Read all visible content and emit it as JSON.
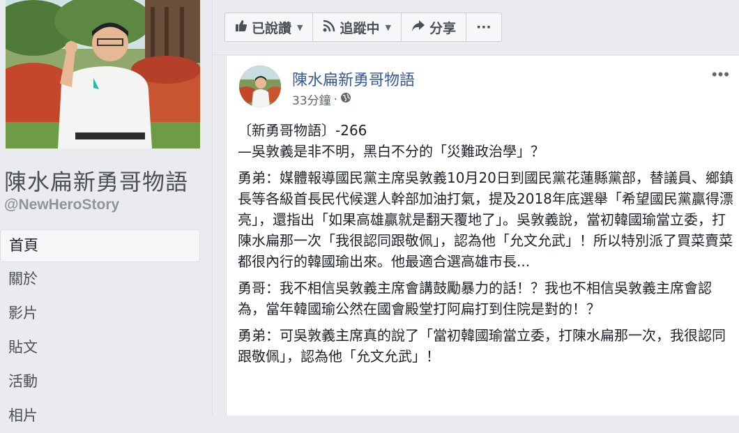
{
  "page": {
    "name": "陳水扁新勇哥物語",
    "handle": "@NewHeroStory"
  },
  "nav": [
    {
      "label": "首頁"
    },
    {
      "label": "關於"
    },
    {
      "label": "影片"
    },
    {
      "label": "貼文"
    },
    {
      "label": "活動"
    },
    {
      "label": "相片"
    }
  ],
  "actions": {
    "liked": "已說讚",
    "following": "追蹤中",
    "share": "分享",
    "more": "···"
  },
  "post": {
    "author": "陳水扁新勇哥物語",
    "time": "33分鐘",
    "privacy_icon": "globe-icon",
    "more": "•••",
    "paragraphs": [
      "〔新勇哥物語〕-266\n—吳敦義是非不明，黑白不分的「災難政治學」？",
      "勇弟：媒體報導國民黨主席吳敦義10月20日到國民黨花蓮縣黨部，替議員、鄉鎮長等各級首長民代候選人幹部加油打氣，提及2018年底選舉「希望國民黨贏得漂亮」，還指出「如果高雄贏就是翻天覆地了」。吳敦義說，當初韓國瑜當立委，打陳水扁那一次「我很認同跟敬佩」，認為他「允文允武」！所以特別派了買菜賣菜都很內行的韓國瑜出來。他最適合選高雄市長...",
      "勇哥：我不相信吳敦義主席會講鼓勵暴力的話！？我也不相信吳敦義主席會認為，當年韓國瑜公然在國會殿堂打阿扁打到住院是對的！？",
      "勇弟：可吳敦義主席真的說了「當初韓國瑜當立委，打陳水扁那一次，我很認同跟敬佩」，認為他「允文允武」！"
    ]
  },
  "colors": {
    "link": "#365899",
    "text": "#1d2129",
    "muted": "#616770",
    "background": "#e9ebee"
  }
}
